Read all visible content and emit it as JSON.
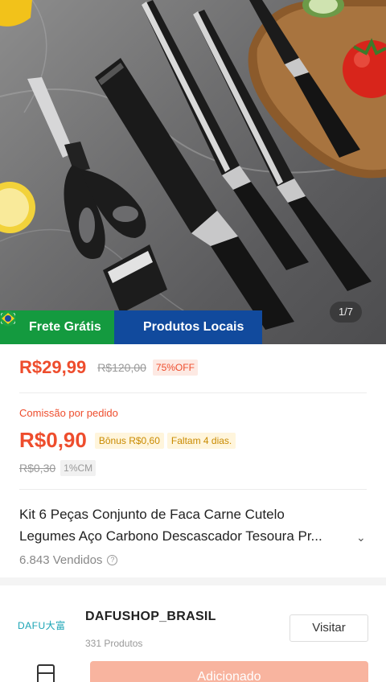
{
  "gallery": {
    "counter": "1/7",
    "badges": {
      "free_shipping": "Frete Grátis",
      "local_products": "Produtos Locais"
    }
  },
  "price": {
    "current": "R$29,99",
    "original": "R$120,00",
    "discount": "75%OFF"
  },
  "commission": {
    "label": "Comissão por pedido",
    "value": "R$0,90",
    "bonus": "Bônus R$0,60",
    "days_left": "Faltam 4 dias.",
    "old_value": "R$0,30",
    "rate": "1%CM"
  },
  "product": {
    "title_line1": "Kit 6 Peças Conjunto de Faca Carne Cutelo",
    "title_line2": "Legumes Aço Carbono Descascador Tesoura Pr...",
    "sold": "6.843 Vendidos"
  },
  "shop": {
    "logo_text": "DAFU大富",
    "name": "DAFUSHOP_BRASIL",
    "products_count": "331 Produtos",
    "visit_label": "Visitar"
  },
  "bottom_bar": {
    "add_label": "Adicionado"
  },
  "colors": {
    "accent": "#ee4d2d",
    "free_shipping_badge": "#149a3f",
    "local_badge": "#114a9d",
    "bonus_chip_text": "#c98a00"
  }
}
